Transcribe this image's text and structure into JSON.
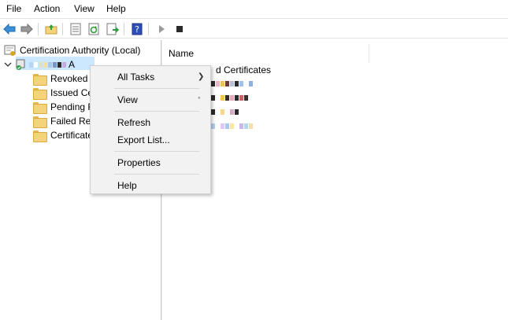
{
  "menu": {
    "file": "File",
    "action": "Action",
    "view": "View",
    "help": "Help"
  },
  "toolbar": {
    "icons": [
      "back-icon",
      "forward-icon",
      "up-folder-icon",
      "show-hide-tree-icon",
      "refresh-icon",
      "export-icon",
      "help-icon",
      "start-service-icon",
      "stop-service-icon"
    ]
  },
  "tree": {
    "root_label": "Certification Authority (Local)",
    "ca_name_suffix": "A",
    "items": [
      {
        "label": "Revoked C"
      },
      {
        "label": "Issued Ce"
      },
      {
        "label": "Pending F"
      },
      {
        "label": "Failed Rec"
      },
      {
        "label": "Certificate"
      }
    ]
  },
  "list": {
    "column_name": "Name",
    "first_row": "d Certificates"
  },
  "context_menu": {
    "all_tasks": "All Tasks",
    "view": "View",
    "refresh": "Refresh",
    "export_list": "Export List...",
    "properties": "Properties",
    "help": "Help"
  },
  "colors": {
    "selection": "#cce8ff",
    "folder": "#f5d37a",
    "menu_bg": "#f2f2f2"
  }
}
